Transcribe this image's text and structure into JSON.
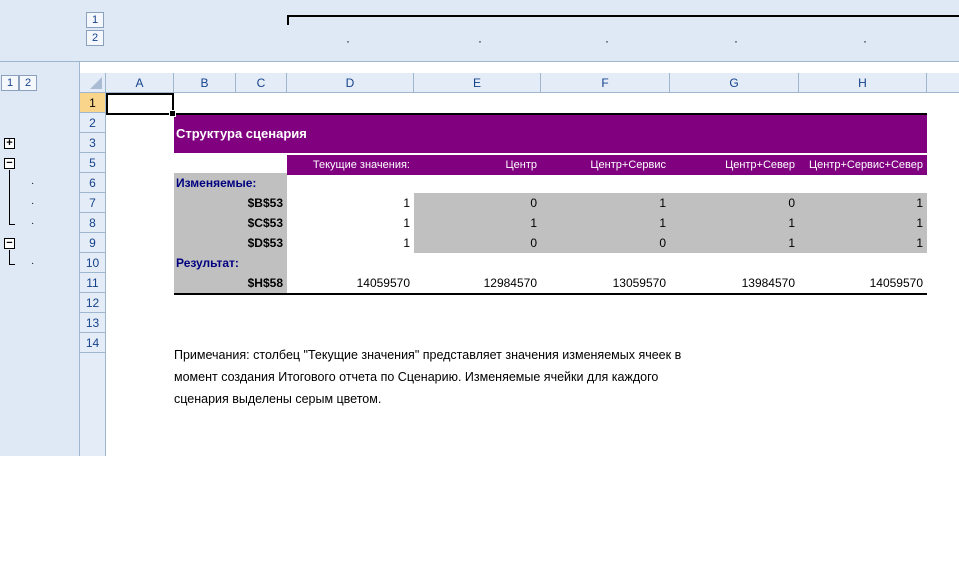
{
  "outline": {
    "col_levels": [
      "1",
      "2"
    ],
    "row_levels": [
      "1",
      "2"
    ],
    "col_dot": "·",
    "row_dot": "·",
    "expand_symbol": "+",
    "collapse_symbol": "−"
  },
  "columns": [
    "A",
    "B",
    "C",
    "D",
    "E",
    "F",
    "G",
    "H"
  ],
  "rows": [
    "1",
    "2",
    "3",
    "5",
    "6",
    "7",
    "8",
    "9",
    "10",
    "11",
    "12",
    "13",
    "14"
  ],
  "report": {
    "title": "Структура сценария",
    "headers": [
      "Текущие значения:",
      "Центр",
      "Центр+Сервис",
      "Центр+Север",
      "Центр+Сервис+Север"
    ],
    "changing_label": "Изменяемые:",
    "changing_rows": [
      {
        "cell": "$B$53",
        "values": [
          "1",
          "0",
          "1",
          "0",
          "1"
        ]
      },
      {
        "cell": "$C$53",
        "values": [
          "1",
          "1",
          "1",
          "1",
          "1"
        ]
      },
      {
        "cell": "$D$53",
        "values": [
          "1",
          "0",
          "0",
          "1",
          "1"
        ]
      }
    ],
    "result_label": "Результат:",
    "result_rows": [
      {
        "cell": "$H$58",
        "values": [
          "14059570",
          "12984570",
          "13059570",
          "13984570",
          "14059570"
        ]
      }
    ],
    "notes": [
      "Примечания: столбец \"Текущие значения\" представляет значения изменяемых ячеек в",
      "момент создания Итогового отчета по Сценарию. Изменяемые ячейки для каждого",
      "сценария выделены серым цветом."
    ]
  },
  "colors": {
    "title_bg": "#800080",
    "changing_cell_bg": "#c0c0c0",
    "label_text": "#000080"
  }
}
